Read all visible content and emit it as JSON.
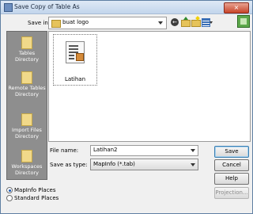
{
  "window": {
    "title": "Save Copy of Table As"
  },
  "toolbar": {
    "save_in_label": "Save in:",
    "save_in_value": "buat logo"
  },
  "places": [
    {
      "label": "Tables Directory"
    },
    {
      "label": "Remote Tables Directory"
    },
    {
      "label": "Import Files Directory"
    },
    {
      "label": "Workspaces Directory"
    }
  ],
  "files": [
    {
      "name": "Latihan"
    }
  ],
  "form": {
    "file_name_label": "File name:",
    "file_name_value": "Latihan2",
    "save_as_type_label": "Save as type:",
    "save_as_type_value": "MapInfo (*.tab)"
  },
  "buttons": {
    "save": "Save",
    "cancel": "Cancel",
    "help": "Help",
    "projection": "Projection..."
  },
  "places_mode": {
    "options": [
      "MapInfo Places",
      "Standard Places"
    ],
    "selected": "MapInfo Places"
  },
  "colors": {
    "places_bg": "#8e8e8e",
    "title_close": "#c8452a"
  }
}
